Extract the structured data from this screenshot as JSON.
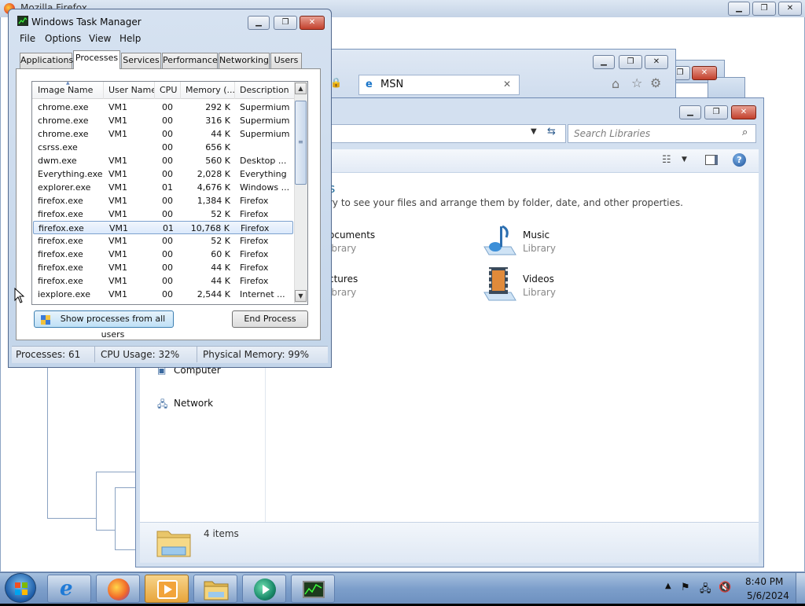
{
  "firefox": {
    "title": "Mozilla Firefox"
  },
  "ie": {
    "tab_label": "MSN",
    "tab_close": "✕"
  },
  "explorer": {
    "search_placeholder": "Search Libraries",
    "heading": "s",
    "description": "ry to see your files and arrange them by folder, date, and other properties.",
    "libraries": [
      {
        "name": "ocuments",
        "sub": "ibrary"
      },
      {
        "name": "Music",
        "sub": "Library"
      },
      {
        "name": "ctures",
        "sub": "ibrary"
      },
      {
        "name": "Videos",
        "sub": "Library"
      }
    ],
    "nav": {
      "computer": "Computer",
      "network": "Network"
    },
    "items_count": "4 items"
  },
  "taskmanager": {
    "title": "Windows Task Manager",
    "menu": [
      "File",
      "Options",
      "View",
      "Help"
    ],
    "tabs": [
      "Applications",
      "Processes",
      "Services",
      "Performance",
      "Networking",
      "Users"
    ],
    "active_tab": "Processes",
    "columns": [
      "Image Name",
      "User Name",
      "CPU",
      "Memory (...",
      "Description"
    ],
    "rows": [
      {
        "name": "chrome.exe",
        "user": "VM1",
        "cpu": "00",
        "mem": "292 K",
        "desc": "Supermium"
      },
      {
        "name": "chrome.exe",
        "user": "VM1",
        "cpu": "00",
        "mem": "316 K",
        "desc": "Supermium"
      },
      {
        "name": "chrome.exe",
        "user": "VM1",
        "cpu": "00",
        "mem": "44 K",
        "desc": "Supermium"
      },
      {
        "name": "csrss.exe",
        "user": "",
        "cpu": "00",
        "mem": "656 K",
        "desc": ""
      },
      {
        "name": "dwm.exe",
        "user": "VM1",
        "cpu": "00",
        "mem": "560 K",
        "desc": "Desktop ..."
      },
      {
        "name": "Everything.exe",
        "user": "VM1",
        "cpu": "00",
        "mem": "2,028 K",
        "desc": "Everything"
      },
      {
        "name": "explorer.exe",
        "user": "VM1",
        "cpu": "01",
        "mem": "4,676 K",
        "desc": "Windows ..."
      },
      {
        "name": "firefox.exe",
        "user": "VM1",
        "cpu": "00",
        "mem": "1,384 K",
        "desc": "Firefox"
      },
      {
        "name": "firefox.exe",
        "user": "VM1",
        "cpu": "00",
        "mem": "52 K",
        "desc": "Firefox"
      },
      {
        "name": "firefox.exe",
        "user": "VM1",
        "cpu": "01",
        "mem": "10,768 K",
        "desc": "Firefox"
      },
      {
        "name": "firefox.exe",
        "user": "VM1",
        "cpu": "00",
        "mem": "52 K",
        "desc": "Firefox"
      },
      {
        "name": "firefox.exe",
        "user": "VM1",
        "cpu": "00",
        "mem": "60 K",
        "desc": "Firefox"
      },
      {
        "name": "firefox.exe",
        "user": "VM1",
        "cpu": "00",
        "mem": "44 K",
        "desc": "Firefox"
      },
      {
        "name": "firefox.exe",
        "user": "VM1",
        "cpu": "00",
        "mem": "44 K",
        "desc": "Firefox"
      },
      {
        "name": "iexplore.exe",
        "user": "VM1",
        "cpu": "00",
        "mem": "2,544 K",
        "desc": "Internet ..."
      }
    ],
    "selected_row": 9,
    "show_all_button": "Show processes from all users",
    "end_process_button": "End Process",
    "status": {
      "processes": "Processes: 61",
      "cpu": "CPU Usage: 32%",
      "memory": "Physical Memory: 99%"
    }
  },
  "taskbar": {
    "buttons": [
      "start-orb",
      "internet-explorer",
      "firefox",
      "media-player",
      "windows-explorer",
      "media-center",
      "task-manager"
    ],
    "active": "media-player",
    "time": "8:40 PM",
    "date": "5/6/2024"
  },
  "colors": {
    "accent": "#1e6a9a",
    "selection": "#dbe9fb",
    "close_button": "#c2402c",
    "taskbar": "#7d9fcb"
  }
}
